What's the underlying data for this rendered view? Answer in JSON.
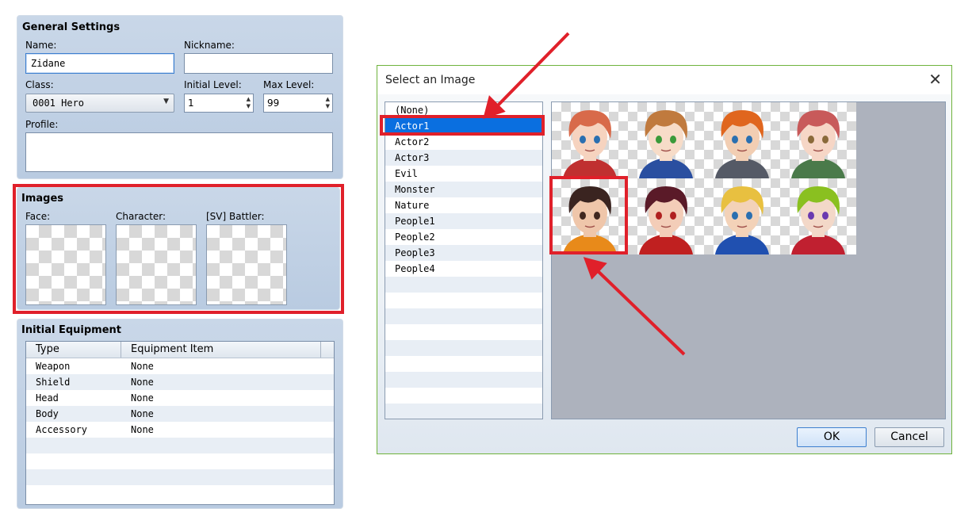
{
  "general": {
    "title": "General Settings",
    "name_label": "Name:",
    "name_value": "Zidane",
    "nickname_label": "Nickname:",
    "nickname_value": "",
    "class_label": "Class:",
    "class_value": "0001 Hero",
    "initial_level_label": "Initial Level:",
    "initial_level_value": "1",
    "max_level_label": "Max Level:",
    "max_level_value": "99",
    "profile_label": "Profile:",
    "profile_value": ""
  },
  "images": {
    "title": "Images",
    "face_label": "Face:",
    "character_label": "Character:",
    "battler_label": "[SV] Battler:"
  },
  "equipment": {
    "title": "Initial Equipment",
    "columns": [
      "Type",
      "Equipment Item"
    ],
    "rows": [
      {
        "type": "Weapon",
        "item": "None"
      },
      {
        "type": "Shield",
        "item": "None"
      },
      {
        "type": "Head",
        "item": "None"
      },
      {
        "type": "Body",
        "item": "None"
      },
      {
        "type": "Accessory",
        "item": "None"
      }
    ]
  },
  "dialog": {
    "title": "Select an Image",
    "close_icon": "close-icon",
    "files": [
      "(None)",
      "Actor1",
      "Actor2",
      "Actor3",
      "Evil",
      "Monster",
      "Nature",
      "People1",
      "People2",
      "People3",
      "People4"
    ],
    "selected_file": "Actor1",
    "faces": [
      {
        "name": "face-1",
        "hair": "#d86a4a",
        "skin": "#f6d3bf",
        "accent": "#c03030",
        "eye": "#2a6fb0"
      },
      {
        "name": "face-2",
        "hair": "#c07a3e",
        "skin": "#f7dcc8",
        "accent": "#2a4fa0",
        "eye": "#3a9a3a"
      },
      {
        "name": "face-3",
        "hair": "#e0661e",
        "skin": "#f2ceb3",
        "accent": "#555a66",
        "eye": "#2a6fb0"
      },
      {
        "name": "face-4",
        "hair": "#c85a5a",
        "skin": "#f6d6c6",
        "accent": "#4a7a4a",
        "eye": "#8a6a3a"
      },
      {
        "name": "face-5",
        "hair": "#3a2420",
        "skin": "#efc6aa",
        "accent": "#e88a1a",
        "eye": "#402820"
      },
      {
        "name": "face-6",
        "hair": "#5a1a28",
        "skin": "#f3cdb8",
        "accent": "#c02020",
        "eye": "#b02020"
      },
      {
        "name": "face-7",
        "hair": "#e8c040",
        "skin": "#f3d2b8",
        "accent": "#2050b0",
        "eye": "#2a6fb0"
      },
      {
        "name": "face-8",
        "hair": "#8ac020",
        "skin": "#f3d8c8",
        "accent": "#c02030",
        "eye": "#6a3ab0"
      }
    ],
    "selected_face_index": 4,
    "ok_label": "OK",
    "cancel_label": "Cancel"
  },
  "colors": {
    "highlight_red": "#e0202a",
    "selection_blue": "#0a6fe0",
    "dialog_border": "#6fb33c"
  }
}
